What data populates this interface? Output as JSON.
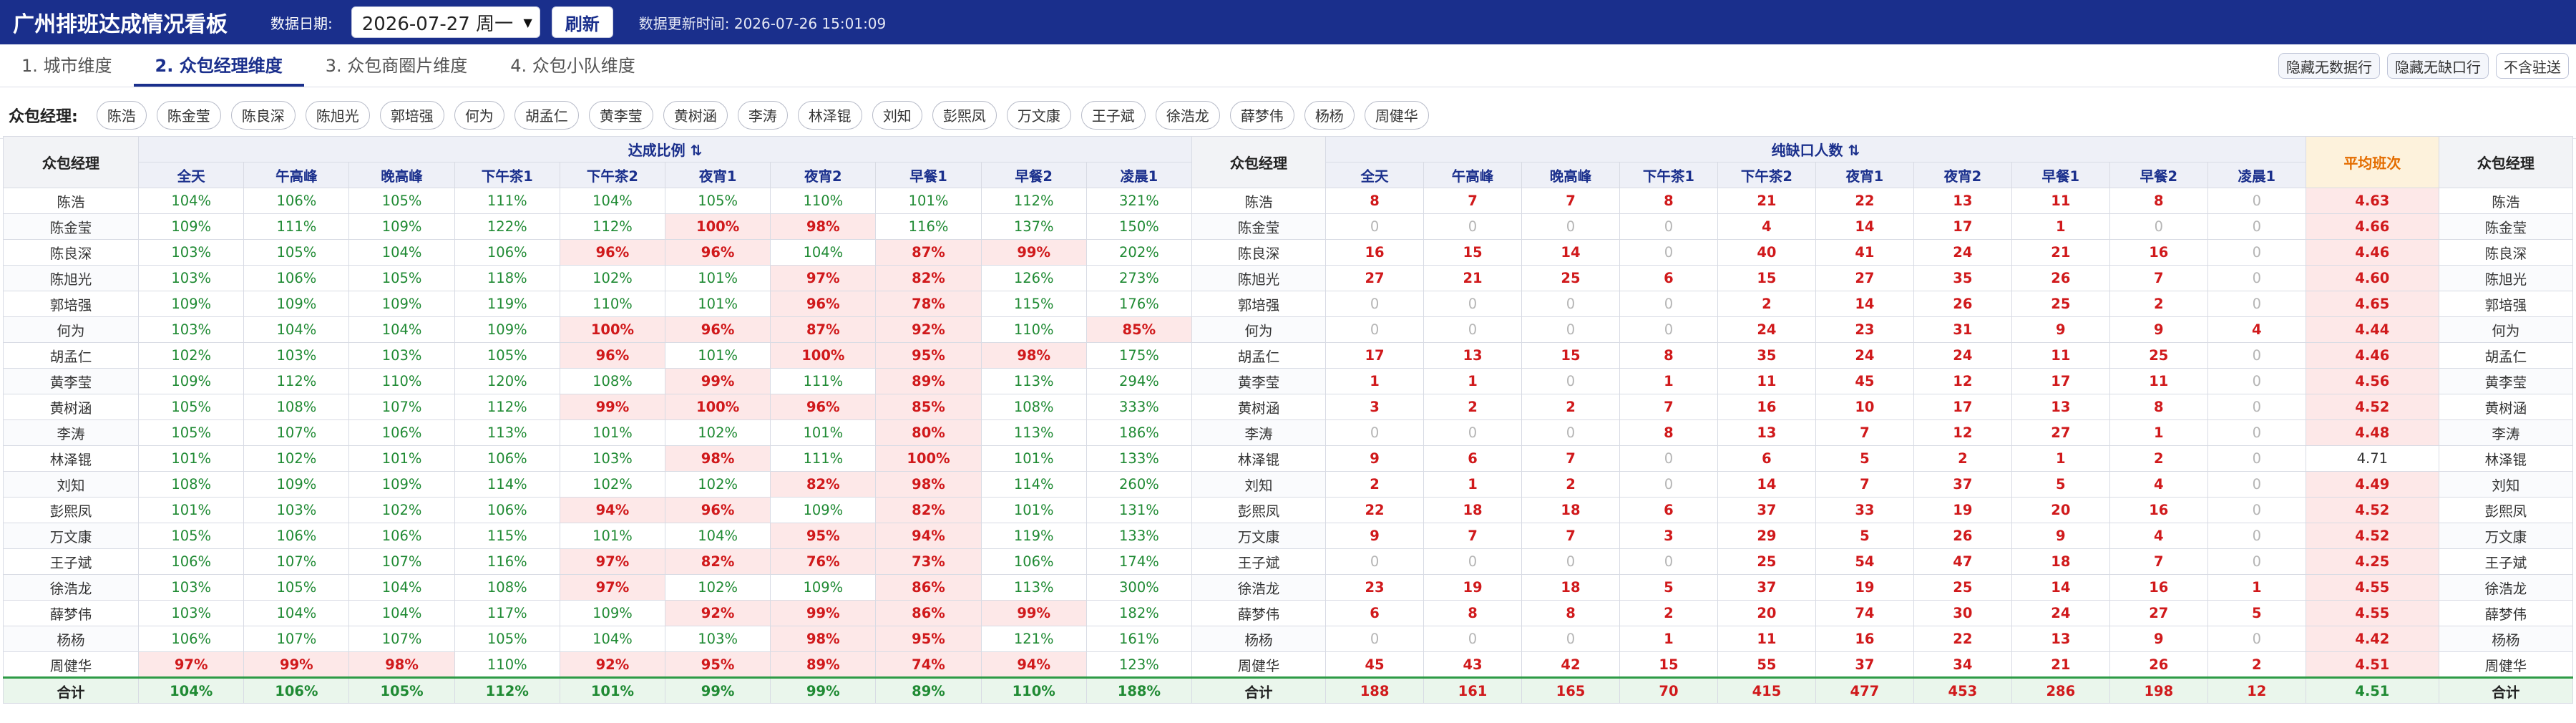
{
  "app_title": "广州排班达成情况看板",
  "date_label": "数据日期:",
  "date_value": "2026-07-27 周一",
  "refresh_label": "刷新",
  "update_time": "数据更新时间: 2026-07-26 15:01:09",
  "tabs": [
    {
      "label": "1. 城市维度",
      "active": false
    },
    {
      "label": "2. 众包经理维度",
      "active": true
    },
    {
      "label": "3. 众包商圈片维度",
      "active": false
    },
    {
      "label": "4. 众包小队维度",
      "active": false
    }
  ],
  "toggles": [
    "隐藏无数据行",
    "隐藏无缺口行",
    "不含驻送"
  ],
  "filter_label": "众包经理:",
  "managers": [
    "陈浩",
    "陈金莹",
    "陈良深",
    "陈旭光",
    "郭培强",
    "何为",
    "胡孟仁",
    "黄李莹",
    "黄树涵",
    "李涛",
    "林泽锟",
    "刘知",
    "彭熙凤",
    "万文康",
    "王子斌",
    "徐浩龙",
    "薛梦伟",
    "杨杨",
    "周健华"
  ],
  "table": {
    "col_manager": "众包经理",
    "group_ratio": "达成比例 ⇅",
    "group_short": "纯缺口人数 ⇅",
    "avg_header": "平均班次",
    "periods": [
      "全天",
      "午高峰",
      "晚高峰",
      "下午茶1",
      "下午茶2",
      "夜宵1",
      "夜宵2",
      "早餐1",
      "早餐2",
      "凌晨1"
    ],
    "rows": [
      {
        "name": "陈浩",
        "ratios": [
          "104%",
          "106%",
          "105%",
          "111%",
          "104%",
          "105%",
          "110%",
          "101%",
          "112%",
          "321%"
        ],
        "shorts": [
          8,
          7,
          7,
          8,
          21,
          22,
          13,
          11,
          8,
          0
        ],
        "avg": "4.63"
      },
      {
        "name": "陈金莹",
        "ratios": [
          "109%",
          "111%",
          "109%",
          "122%",
          "112%",
          "100%",
          "98%",
          "116%",
          "137%",
          "150%"
        ],
        "shorts": [
          0,
          0,
          0,
          0,
          4,
          14,
          17,
          1,
          0,
          0
        ],
        "avg": "4.66"
      },
      {
        "name": "陈良深",
        "ratios": [
          "103%",
          "105%",
          "104%",
          "106%",
          "96%",
          "96%",
          "104%",
          "87%",
          "99%",
          "202%"
        ],
        "shorts": [
          16,
          15,
          14,
          0,
          40,
          41,
          24,
          21,
          16,
          0
        ],
        "avg": "4.46"
      },
      {
        "name": "陈旭光",
        "ratios": [
          "103%",
          "106%",
          "105%",
          "118%",
          "102%",
          "101%",
          "97%",
          "82%",
          "126%",
          "273%"
        ],
        "shorts": [
          27,
          21,
          25,
          6,
          15,
          27,
          35,
          26,
          7,
          0
        ],
        "avg": "4.60"
      },
      {
        "name": "郭培强",
        "ratios": [
          "109%",
          "109%",
          "109%",
          "119%",
          "110%",
          "101%",
          "96%",
          "78%",
          "115%",
          "176%"
        ],
        "shorts": [
          0,
          0,
          0,
          0,
          2,
          14,
          26,
          25,
          2,
          0
        ],
        "avg": "4.65"
      },
      {
        "name": "何为",
        "ratios": [
          "103%",
          "104%",
          "104%",
          "109%",
          "100%",
          "96%",
          "87%",
          "92%",
          "110%",
          "85%"
        ],
        "shorts": [
          0,
          0,
          0,
          0,
          24,
          23,
          31,
          9,
          9,
          4
        ],
        "avg": "4.44"
      },
      {
        "name": "胡孟仁",
        "ratios": [
          "102%",
          "103%",
          "103%",
          "105%",
          "96%",
          "101%",
          "100%",
          "95%",
          "98%",
          "175%"
        ],
        "shorts": [
          17,
          13,
          15,
          8,
          35,
          24,
          24,
          11,
          25,
          0
        ],
        "avg": "4.46"
      },
      {
        "name": "黄李莹",
        "ratios": [
          "109%",
          "112%",
          "110%",
          "120%",
          "108%",
          "99%",
          "111%",
          "89%",
          "113%",
          "294%"
        ],
        "shorts": [
          1,
          1,
          0,
          1,
          11,
          45,
          12,
          17,
          11,
          0
        ],
        "avg": "4.56"
      },
      {
        "name": "黄树涵",
        "ratios": [
          "105%",
          "108%",
          "107%",
          "112%",
          "99%",
          "100%",
          "96%",
          "85%",
          "108%",
          "333%"
        ],
        "shorts": [
          3,
          2,
          2,
          7,
          16,
          10,
          17,
          13,
          8,
          0
        ],
        "avg": "4.52"
      },
      {
        "name": "李涛",
        "ratios": [
          "105%",
          "107%",
          "106%",
          "113%",
          "101%",
          "102%",
          "101%",
          "80%",
          "113%",
          "186%"
        ],
        "shorts": [
          0,
          0,
          0,
          8,
          13,
          7,
          12,
          27,
          1,
          0
        ],
        "avg": "4.48"
      },
      {
        "name": "林泽锟",
        "ratios": [
          "101%",
          "102%",
          "101%",
          "106%",
          "103%",
          "98%",
          "111%",
          "100%",
          "101%",
          "133%"
        ],
        "shorts": [
          9,
          6,
          7,
          0,
          6,
          5,
          2,
          1,
          2,
          0
        ],
        "avg": "4.71"
      },
      {
        "name": "刘知",
        "ratios": [
          "108%",
          "109%",
          "109%",
          "114%",
          "102%",
          "102%",
          "82%",
          "98%",
          "114%",
          "260%"
        ],
        "shorts": [
          2,
          1,
          2,
          0,
          14,
          7,
          37,
          5,
          4,
          0
        ],
        "avg": "4.49"
      },
      {
        "name": "彭熙凤",
        "ratios": [
          "101%",
          "103%",
          "102%",
          "106%",
          "94%",
          "96%",
          "109%",
          "82%",
          "101%",
          "131%"
        ],
        "shorts": [
          22,
          18,
          18,
          6,
          37,
          33,
          19,
          20,
          16,
          0
        ],
        "avg": "4.52"
      },
      {
        "name": "万文康",
        "ratios": [
          "105%",
          "106%",
          "106%",
          "115%",
          "101%",
          "104%",
          "95%",
          "94%",
          "119%",
          "133%"
        ],
        "shorts": [
          9,
          7,
          7,
          3,
          29,
          5,
          26,
          9,
          4,
          0
        ],
        "avg": "4.52"
      },
      {
        "name": "王子斌",
        "ratios": [
          "106%",
          "107%",
          "107%",
          "116%",
          "97%",
          "82%",
          "76%",
          "73%",
          "106%",
          "174%"
        ],
        "shorts": [
          0,
          0,
          0,
          0,
          25,
          54,
          47,
          18,
          7,
          0
        ],
        "avg": "4.25"
      },
      {
        "name": "徐浩龙",
        "ratios": [
          "103%",
          "105%",
          "104%",
          "108%",
          "97%",
          "102%",
          "109%",
          "86%",
          "113%",
          "300%"
        ],
        "shorts": [
          23,
          19,
          18,
          5,
          37,
          19,
          25,
          14,
          16,
          1
        ],
        "avg": "4.55"
      },
      {
        "name": "薛梦伟",
        "ratios": [
          "103%",
          "104%",
          "104%",
          "117%",
          "109%",
          "92%",
          "99%",
          "86%",
          "99%",
          "182%"
        ],
        "shorts": [
          6,
          8,
          8,
          2,
          20,
          74,
          30,
          24,
          27,
          5
        ],
        "avg": "4.55"
      },
      {
        "name": "杨杨",
        "ratios": [
          "106%",
          "107%",
          "107%",
          "105%",
          "104%",
          "103%",
          "98%",
          "95%",
          "121%",
          "161%"
        ],
        "shorts": [
          0,
          0,
          0,
          1,
          11,
          16,
          22,
          13,
          9,
          0
        ],
        "avg": "4.42"
      },
      {
        "name": "周健华",
        "ratios": [
          "97%",
          "99%",
          "98%",
          "110%",
          "92%",
          "95%",
          "89%",
          "74%",
          "94%",
          "123%"
        ],
        "shorts": [
          45,
          43,
          42,
          15,
          55,
          37,
          34,
          21,
          26,
          2
        ],
        "avg": "4.51"
      }
    ],
    "total": {
      "name": "合计",
      "ratios": [
        "104%",
        "106%",
        "105%",
        "112%",
        "101%",
        "99%",
        "99%",
        "89%",
        "110%",
        "188%"
      ],
      "shorts": [
        188,
        161,
        165,
        70,
        415,
        477,
        453,
        286,
        198,
        12
      ],
      "avg": "4.51"
    }
  },
  "colors": {
    "header_bg": "#1a2f8c",
    "ok_green": "#1f8a33",
    "alert_red": "#d0191b",
    "avg_orange": "#e46d00"
  }
}
